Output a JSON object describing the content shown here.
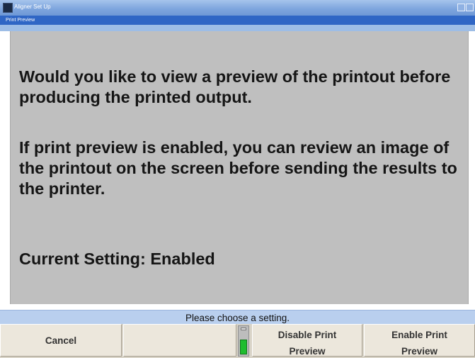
{
  "window": {
    "title": "Aligner Set Up",
    "icon": "app-icon",
    "controls": [
      "minimize-icon",
      "maximize-icon"
    ]
  },
  "dialog": {
    "title": "Print Preview"
  },
  "content": {
    "question": "Would you like to view a preview of the printout before producing the printed output.",
    "explanation": "If print preview is enabled, you can review an image of the printout on the screen before sending the results to the printer.",
    "current_setting": "Current Setting: Enabled"
  },
  "status": {
    "prompt": "Please choose a setting."
  },
  "buttons": {
    "cancel": "Cancel",
    "blank": "",
    "disable_line1": "Disable Print",
    "disable_line2": "Preview",
    "enable_line1": "Enable Print",
    "enable_line2": "Preview"
  },
  "indicator": {
    "level": 0.55,
    "color": "#1fbd2f"
  },
  "colors": {
    "titlebar": "#7fa6de",
    "subtitle_bar": "#2f66c5",
    "content_background": "#bfbfbf",
    "status_bar": "#b9cfee",
    "button_face": "#ece7dc"
  }
}
